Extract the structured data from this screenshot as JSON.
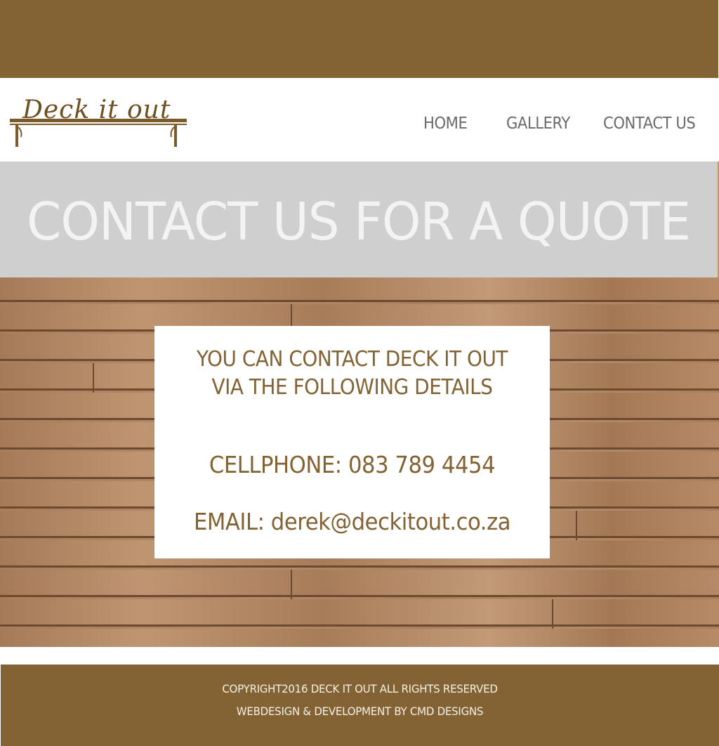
{
  "logo": {
    "text": "Deck it out",
    "icon": "bench-icon"
  },
  "nav": {
    "items": [
      {
        "label": "HOME"
      },
      {
        "label": "GALLERY"
      },
      {
        "label": "CONTACT US"
      }
    ]
  },
  "banner": {
    "title": "CONTACT US FOR A QUOTE"
  },
  "contact_card": {
    "heading_line1": "YOU CAN CONTACT DECK IT OUT",
    "heading_line2": "VIA THE FOLLOWING DETAILS",
    "phone": "CELLPHONE: 083 789 4454",
    "email": "EMAIL: derek@deckitout.co.za"
  },
  "footer": {
    "copyright": "COPYRIGHT2016 DECK IT OUT ALL RIGHTS RESERVED",
    "credit": "WEBDESIGN & DEVELOPMENT BY CMD DESIGNS"
  },
  "colors": {
    "brand_brown": "#836234",
    "banner_gray": "#cfcfcf",
    "nav_text": "#6a6a6a",
    "wood": "#b08562"
  }
}
